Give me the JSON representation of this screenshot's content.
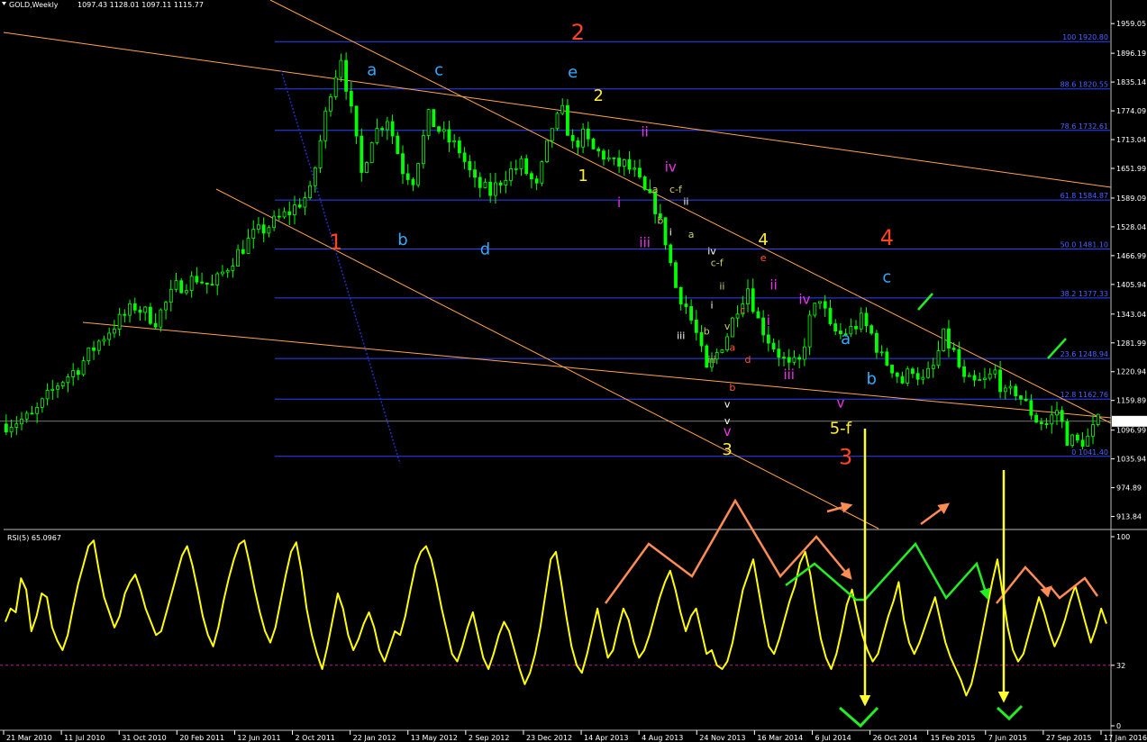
{
  "header": {
    "symbol_label": "GOLD,Weekly",
    "ohlc_label": "1097.43 1128.01 1097.11 1115.77"
  },
  "rsi_header": "RSI(5) 65.0967",
  "colors": {
    "background": "#000000",
    "candle_up": "#00ff00",
    "candle_down": "#00ff00",
    "fib_line": "#3040ff",
    "trendline": "#ffa54a",
    "rsi_line": "#ffff00",
    "orange_arrow": "#ff8c55",
    "green_arrow": "#22ee22",
    "blue_dotted": "#2030c0",
    "price_box": "#ffffff"
  },
  "chart_data": [
    {
      "type": "candlestick",
      "title": "GOLD,Weekly",
      "y_ticks": [
        "1959.05",
        "1896.19",
        "1835.14",
        "1774.09",
        "1713.04",
        "1651.99",
        "1589.09",
        "1528.04",
        "1466.99",
        "1405.94",
        "1343.04",
        "1281.99",
        "1220.94",
        "1159.89",
        "1096.99",
        "1035.94",
        "974.89",
        "913.84"
      ],
      "x_ticks": [
        "21 Mar 2010",
        "11 Jul 2010",
        "31 Oct 2010",
        "20 Feb 2011",
        "12 Jun 2011",
        "2 Oct 2011",
        "22 Jan 2012",
        "13 May 2012",
        "2 Sep 2012",
        "23 Dec 2012",
        "14 Apr 2013",
        "4 Aug 2013",
        "24 Nov 2013",
        "16 Mar 2014",
        "6 Jul 2014",
        "26 Oct 2014",
        "15 Feb 2015",
        "7 Jun 2015",
        "27 Sep 2015",
        "17 Jan 2016"
      ],
      "current_price": "1115.77",
      "ylim": [
        892,
        1990
      ],
      "close_path": [
        [
          0,
          1110
        ],
        [
          5,
          1125
        ],
        [
          10,
          1195
        ],
        [
          14,
          1230
        ],
        [
          18,
          1285
        ],
        [
          21,
          1320
        ],
        [
          25,
          1360
        ],
        [
          29,
          1330
        ],
        [
          33,
          1400
        ],
        [
          37,
          1420
        ],
        [
          40,
          1400
        ],
        [
          44,
          1460
        ],
        [
          48,
          1510
        ],
        [
          51,
          1530
        ],
        [
          55,
          1560
        ],
        [
          59,
          1600
        ],
        [
          63,
          1820
        ],
        [
          65,
          1890
        ],
        [
          67,
          1770
        ],
        [
          69,
          1640
        ],
        [
          71,
          1720
        ],
        [
          74,
          1760
        ],
        [
          77,
          1650
        ],
        [
          79,
          1630
        ],
        [
          82,
          1760
        ],
        [
          85,
          1720
        ],
        [
          88,
          1690
        ],
        [
          91,
          1620
        ],
        [
          94,
          1600
        ],
        [
          97,
          1640
        ],
        [
          100,
          1660
        ],
        [
          103,
          1610
        ],
        [
          106,
          1740
        ],
        [
          108,
          1770
        ],
        [
          110,
          1700
        ],
        [
          112,
          1720
        ],
        [
          114,
          1690
        ],
        [
          116,
          1680
        ],
        [
          118,
          1660
        ],
        [
          120,
          1660
        ],
        [
          122,
          1640
        ],
        [
          124,
          1600
        ],
        [
          126,
          1570
        ],
        [
          128,
          1500
        ],
        [
          130,
          1400
        ],
        [
          132,
          1360
        ],
        [
          134,
          1300
        ],
        [
          136,
          1220
        ],
        [
          138,
          1260
        ],
        [
          140,
          1300
        ],
        [
          142,
          1360
        ],
        [
          144,
          1400
        ],
        [
          146,
          1330
        ],
        [
          148,
          1290
        ],
        [
          150,
          1260
        ],
        [
          152,
          1230
        ],
        [
          154,
          1240
        ],
        [
          156,
          1330
        ],
        [
          158,
          1380
        ],
        [
          160,
          1310
        ],
        [
          162,
          1300
        ],
        [
          164,
          1310
        ],
        [
          166,
          1330
        ],
        [
          168,
          1300
        ],
        [
          170,
          1250
        ],
        [
          172,
          1230
        ],
        [
          174,
          1200
        ],
        [
          176,
          1230
        ],
        [
          178,
          1200
        ],
        [
          180,
          1230
        ],
        [
          182,
          1295
        ],
        [
          184,
          1260
        ],
        [
          186,
          1200
        ],
        [
          188,
          1195
        ],
        [
          190,
          1200
        ],
        [
          192,
          1220
        ],
        [
          194,
          1170
        ],
        [
          196,
          1180
        ],
        [
          198,
          1150
        ],
        [
          200,
          1120
        ],
        [
          202,
          1110
        ],
        [
          204,
          1140
        ],
        [
          206,
          1080
        ],
        [
          208,
          1070
        ],
        [
          210,
          1080
        ],
        [
          212,
          1115
        ]
      ],
      "fib_levels": [
        {
          "label": "100 1920.80",
          "price": 1920.8
        },
        {
          "label": "88.6 1820.55",
          "price": 1820.55
        },
        {
          "label": "78.6 1732.61",
          "price": 1732.61
        },
        {
          "label": "61.8 1584.87",
          "price": 1584.87
        },
        {
          "label": "50.0 1481.10",
          "price": 1481.1
        },
        {
          "label": "38.2 1377.33",
          "price": 1377.33
        },
        {
          "label": "23.6 1248.94",
          "price": 1248.94
        },
        {
          "label": "12.8 1162.76",
          "price": 1162.76
        },
        {
          "label": "0 1041.40",
          "price": 1041.4
        }
      ],
      "wave_labels": [
        {
          "text": "1",
          "week": 64,
          "price": 1480,
          "color": "#ff4422",
          "size": 24
        },
        {
          "text": "2",
          "week": 111,
          "price": 1925,
          "color": "#ff4422",
          "size": 24
        },
        {
          "text": "3",
          "week": 163,
          "price": 1025,
          "color": "#ff4422",
          "size": 24
        },
        {
          "text": "4",
          "week": 171,
          "price": 1490,
          "color": "#ff4422",
          "size": 24
        },
        {
          "text": "a",
          "week": 71,
          "price": 1850,
          "color": "#33aaff",
          "size": 18
        },
        {
          "text": "c",
          "week": 84,
          "price": 1850,
          "color": "#33aaff",
          "size": 18
        },
        {
          "text": "e",
          "week": 110,
          "price": 1845,
          "color": "#33aaff",
          "size": 18
        },
        {
          "text": "b",
          "week": 77,
          "price": 1490,
          "color": "#33aaff",
          "size": 18
        },
        {
          "text": "d",
          "week": 93,
          "price": 1470,
          "color": "#33aaff",
          "size": 18
        },
        {
          "text": "c",
          "week": 171,
          "price": 1410,
          "color": "#33aaff",
          "size": 18
        },
        {
          "text": "a",
          "week": 163,
          "price": 1280,
          "color": "#33aaff",
          "size": 18
        },
        {
          "text": "b",
          "week": 168,
          "price": 1195,
          "color": "#33aaff",
          "size": 18
        },
        {
          "text": "2",
          "week": 115,
          "price": 1795,
          "color": "#ffee33",
          "size": 18
        },
        {
          "text": "1",
          "week": 112,
          "price": 1625,
          "color": "#ffee33",
          "size": 18
        },
        {
          "text": "4",
          "week": 147,
          "price": 1490,
          "color": "#ffee33",
          "size": 18
        },
        {
          "text": "3",
          "week": 140,
          "price": 1045,
          "color": "#ffee33",
          "size": 18
        },
        {
          "text": "5-f",
          "week": 162,
          "price": 1090,
          "color": "#ffee33",
          "size": 18
        },
        {
          "text": "ii",
          "week": 124,
          "price": 1720,
          "color": "#ee33ee",
          "size": 15
        },
        {
          "text": "iv",
          "week": 129,
          "price": 1645,
          "color": "#ee33ee",
          "size": 15
        },
        {
          "text": "i",
          "week": 119,
          "price": 1570,
          "color": "#ee33ee",
          "size": 15
        },
        {
          "text": "iii",
          "week": 124,
          "price": 1485,
          "color": "#ee33ee",
          "size": 15
        },
        {
          "text": "ii",
          "week": 149,
          "price": 1395,
          "color": "#ee33ee",
          "size": 15
        },
        {
          "text": "iv",
          "week": 155,
          "price": 1365,
          "color": "#ee33ee",
          "size": 15
        },
        {
          "text": "i",
          "week": 148,
          "price": 1320,
          "color": "#ee33ee",
          "size": 15
        },
        {
          "text": "iii",
          "week": 152,
          "price": 1205,
          "color": "#ee33ee",
          "size": 15
        },
        {
          "text": "v",
          "week": 140,
          "price": 1085,
          "color": "#ee33ee",
          "size": 15
        },
        {
          "text": "v",
          "week": 162,
          "price": 1145,
          "color": "#ee33ee",
          "size": 15
        },
        {
          "text": "a",
          "week": 126,
          "price": 1600,
          "color": "#cccc66",
          "size": 11
        },
        {
          "text": "c-f",
          "week": 130,
          "price": 1600,
          "color": "#cccc66",
          "size": 11
        },
        {
          "text": "b",
          "week": 127,
          "price": 1535,
          "color": "#cccc66",
          "size": 11
        },
        {
          "text": "ii",
          "week": 132,
          "price": 1575,
          "color": "#ffffff",
          "size": 11
        },
        {
          "text": "i",
          "week": 129,
          "price": 1510,
          "color": "#ffffff",
          "size": 11
        },
        {
          "text": "a",
          "week": 133,
          "price": 1505,
          "color": "#cccc66",
          "size": 11
        },
        {
          "text": "iv",
          "week": 137,
          "price": 1470,
          "color": "#ffffff",
          "size": 11
        },
        {
          "text": "c-f",
          "week": 138,
          "price": 1445,
          "color": "#cccc66",
          "size": 11
        },
        {
          "text": "ii",
          "week": 139,
          "price": 1395,
          "color": "#cccc66",
          "size": 11
        },
        {
          "text": "i",
          "week": 137,
          "price": 1355,
          "color": "#ffffff",
          "size": 11
        },
        {
          "text": "iii",
          "week": 131,
          "price": 1290,
          "color": "#ffffff",
          "size": 11
        },
        {
          "text": "b",
          "week": 136,
          "price": 1300,
          "color": "#cccc66",
          "size": 11
        },
        {
          "text": "v",
          "week": 140,
          "price": 1310,
          "color": "#cccc66",
          "size": 11
        },
        {
          "text": "iii",
          "week": 137,
          "price": 1240,
          "color": "#cccc66",
          "size": 11
        },
        {
          "text": "a",
          "week": 141,
          "price": 1265,
          "color": "#ff5533",
          "size": 11
        },
        {
          "text": "b",
          "week": 141,
          "price": 1180,
          "color": "#ff5533",
          "size": 11
        },
        {
          "text": "c",
          "week": 143,
          "price": 1345,
          "color": "#ff5533",
          "size": 11
        },
        {
          "text": "d",
          "week": 144,
          "price": 1240,
          "color": "#ff5533",
          "size": 11
        },
        {
          "text": "e",
          "week": 147,
          "price": 1455,
          "color": "#ff5533",
          "size": 11
        },
        {
          "text": "v",
          "week": 140,
          "price": 1145,
          "color": "#ffffff",
          "size": 11
        },
        {
          "text": "v",
          "week": 140,
          "price": 1110,
          "color": "#ffffff",
          "size": 11
        }
      ]
    },
    {
      "type": "line",
      "title": "RSI(5) 65.0967",
      "y_ticks": [
        "100",
        "32",
        "0"
      ],
      "ylim": [
        0,
        100
      ],
      "reference_level": 32,
      "series": [
        {
          "name": "RSI(5)",
          "values": [
            55,
            62,
            60,
            78,
            72,
            50,
            58,
            70,
            68,
            52,
            45,
            40,
            48,
            62,
            75,
            85,
            95,
            98,
            82,
            68,
            60,
            52,
            58,
            70,
            76,
            80,
            72,
            62,
            55,
            48,
            50,
            60,
            70,
            80,
            90,
            95,
            85,
            72,
            58,
            48,
            42,
            52,
            66,
            78,
            88,
            96,
            98,
            86,
            72,
            60,
            50,
            44,
            52,
            66,
            80,
            92,
            97,
            82,
            62,
            48,
            38,
            30,
            42,
            56,
            70,
            62,
            48,
            40,
            46,
            54,
            60,
            52,
            40,
            34,
            42,
            50,
            48,
            58,
            72,
            85,
            92,
            95,
            88,
            76,
            62,
            50,
            38,
            34,
            42,
            52,
            60,
            48,
            36,
            30,
            38,
            48,
            55,
            50,
            40,
            30,
            22,
            28,
            38,
            52,
            70,
            88,
            92,
            76,
            58,
            42,
            32,
            28,
            38,
            50,
            62,
            48,
            36,
            40,
            52,
            62,
            56,
            44,
            36,
            40,
            48,
            58,
            68,
            76,
            82,
            72,
            60,
            50,
            58,
            62,
            50,
            38,
            40,
            32,
            30,
            34,
            44,
            58,
            72,
            80,
            88,
            72,
            56,
            42,
            38,
            46,
            56,
            66,
            74,
            86,
            92,
            80,
            62,
            46,
            36,
            30,
            38,
            50,
            64,
            72,
            60,
            48,
            40,
            34,
            38,
            48,
            58,
            66,
            76,
            56,
            44,
            38,
            44,
            52,
            60,
            68,
            56,
            44,
            36,
            30,
            24,
            16,
            22,
            34,
            48,
            62,
            76,
            88,
            70,
            52,
            40,
            34,
            38,
            48,
            58,
            68,
            60,
            50,
            42,
            48,
            56,
            66,
            74,
            64,
            54,
            44,
            52,
            62,
            54
          ]
        }
      ]
    }
  ]
}
